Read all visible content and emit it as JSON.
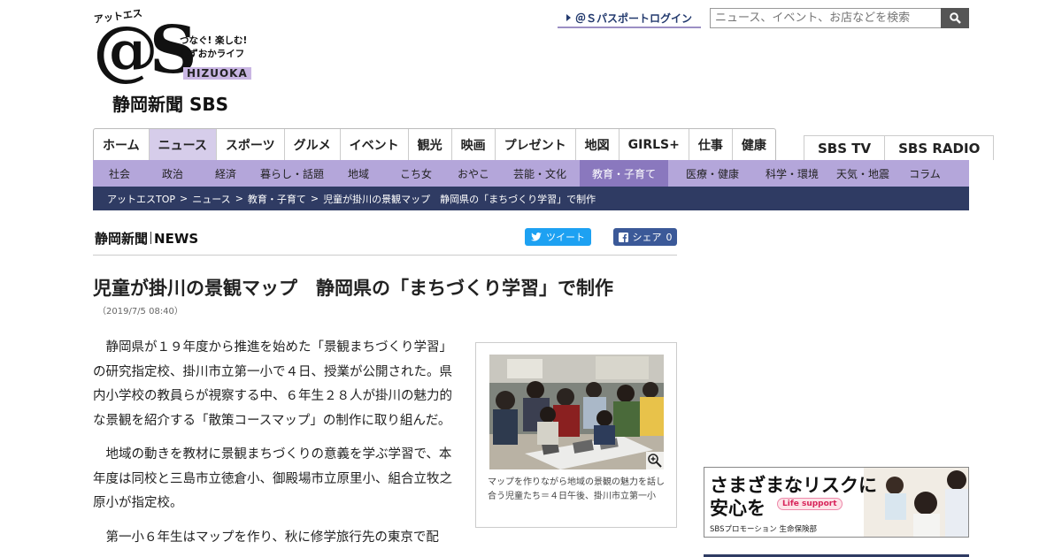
{
  "header": {
    "logo": {
      "kana": "アットエス",
      "mark": "@S",
      "tagline_1": "つなぐ! 楽しむ!",
      "tagline_2": "しずおかライフ",
      "shizuoka": "HIZUOKA",
      "paper": "静岡新聞 SBS"
    },
    "login_label": "＠Ｓパスポートログイン",
    "search": {
      "placeholder": "ニュース、イベント、お店などを検索"
    }
  },
  "main_nav": {
    "tabs": [
      {
        "label": "ホーム",
        "active": false
      },
      {
        "label": "ニュース",
        "active": true
      },
      {
        "label": "スポーツ",
        "active": false
      },
      {
        "label": "グルメ",
        "active": false
      },
      {
        "label": "イベント",
        "active": false
      },
      {
        "label": "観光",
        "active": false
      },
      {
        "label": "映画",
        "active": false
      },
      {
        "label": "プレゼント",
        "active": false
      },
      {
        "label": "地図",
        "active": false
      },
      {
        "label": "GIRLS+",
        "active": false
      },
      {
        "label": "仕事",
        "active": false
      },
      {
        "label": "健康",
        "active": false
      }
    ],
    "brand_tabs": [
      "SBS TV",
      "SBS RADIO"
    ]
  },
  "sub_nav": {
    "items": [
      {
        "label": "社会",
        "active": false
      },
      {
        "label": "政治",
        "active": false
      },
      {
        "label": "経済",
        "active": false
      },
      {
        "label": "暮らし・話題",
        "active": false
      },
      {
        "label": "地域",
        "active": false
      },
      {
        "label": "こち女",
        "active": false
      },
      {
        "label": "おやこ",
        "active": false
      },
      {
        "label": "芸能・文化",
        "active": false
      },
      {
        "label": "教育・子育て",
        "active": true
      },
      {
        "label": "医療・健康",
        "active": false
      },
      {
        "label": "科学・環境",
        "active": false
      },
      {
        "label": "天気・地震",
        "active": false
      },
      {
        "label": "コラム",
        "active": false
      }
    ]
  },
  "breadcrumb": {
    "items": [
      "アットエスTOP",
      "ニュース",
      "教育・子育て",
      "児童が掛川の景観マップ　静岡県の「まちづくり学習」で制作"
    ],
    "separator": ">"
  },
  "article": {
    "source_name": "静岡新聞",
    "source_suffix": "NEWS",
    "tweet_label": "ツイート",
    "share_label": "シェア",
    "share_count": "0",
    "title": "児童が掛川の景観マップ　静岡県の「まちづくり学習」で制作",
    "date": "（2019/7/5 08:40）",
    "paragraphs": [
      "静岡県が１９年度から推進を始めた「景観まちづくり学習」の研究指定校、掛川市立第一小で４日、授業が公開された。県内小学校の教員らが視察する中、６年生２８人が掛川の魅力的な景観を紹介する「散策コースマップ」の制作に取り組んだ。",
      "地域の動きを教材に景観まちづくりの意義を学ぶ学習で、本年度は同校と三島市立徳倉小、御殿場市立原里小、組合立牧之原小が指定校。",
      "第一小６年生はマップを作り、秋に修学旅行先の東京で配"
    ],
    "photo_caption": "マップを作りながら地域の景観の魅力を話し合う児童たち＝４日午後、掛川市立第一小"
  },
  "ad": {
    "line_1": "さまざまなリスクに",
    "line_2": "安心を",
    "badge": "Life support",
    "footer": "SBSプロモーション 生命保険部"
  },
  "colors": {
    "nav_active": "#d6cdea",
    "subnav_bg": "#b4a6da",
    "subnav_active": "#8a78be",
    "breadcrumb_bg": "#2f3b63",
    "twitter": "#1da1f2",
    "facebook": "#3b5998"
  }
}
